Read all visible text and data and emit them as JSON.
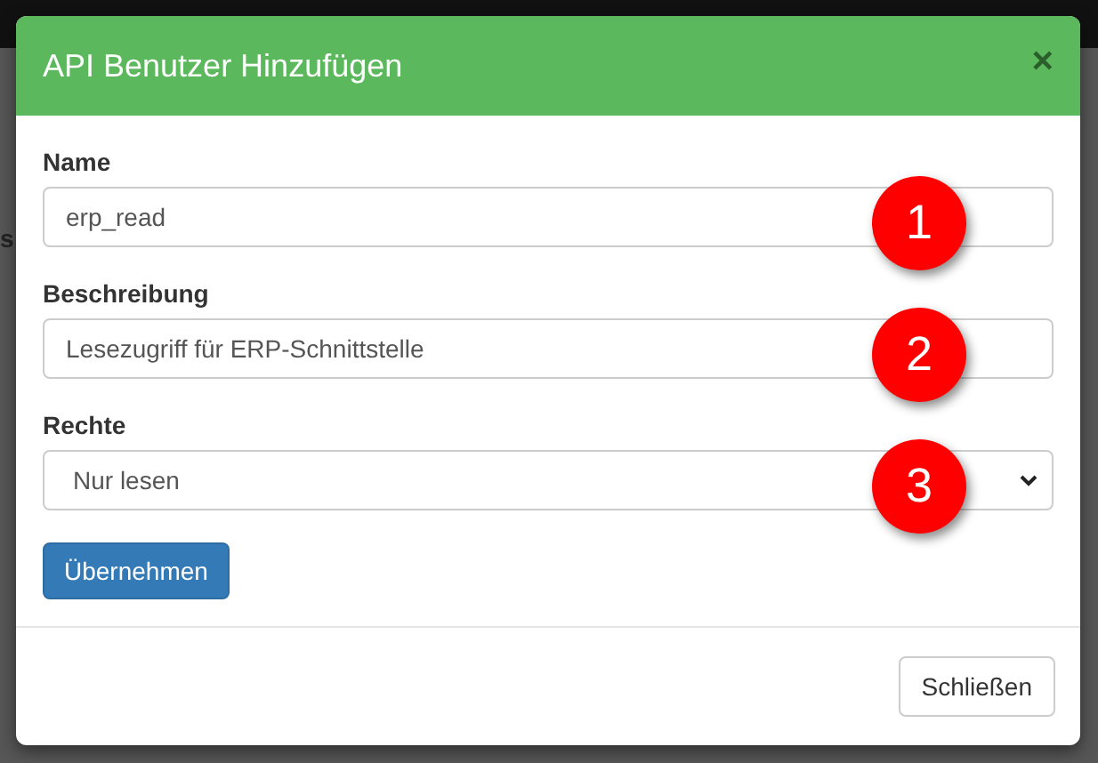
{
  "background": {
    "text": "s"
  },
  "dialog": {
    "title": "API Benutzer Hinzufügen",
    "close": "×",
    "fields": [
      {
        "kind": "input",
        "label": "Name",
        "value": "erp_read",
        "badge": "1"
      },
      {
        "kind": "input",
        "label": "Beschreibung",
        "value": "Lesezugriff für ERP-Schnittstelle",
        "badge": "2"
      },
      {
        "kind": "select",
        "label": "Rechte",
        "value": "Nur lesen",
        "badge": "3"
      }
    ],
    "submit": "Übernehmen",
    "footer_button": "Schließen"
  }
}
